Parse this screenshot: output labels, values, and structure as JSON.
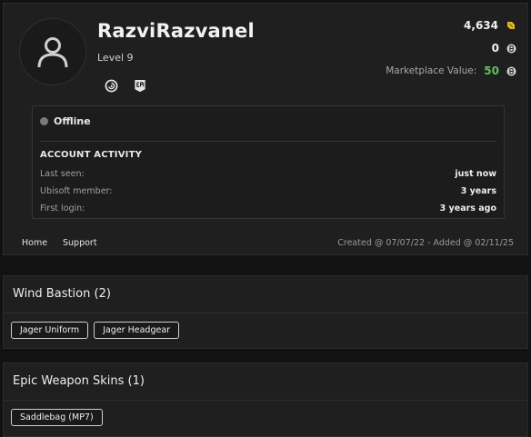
{
  "profile": {
    "username": "RazviRazvanel",
    "level": "Level 9",
    "platforms": [
      "ubisoft-icon",
      "epic-games-icon"
    ],
    "stats": {
      "credits": "4,634",
      "coins": "0",
      "marketplace_label": "Marketplace Value:",
      "marketplace_value": "50"
    },
    "colors": {
      "marketplace_value": "#5fc161",
      "credit_icon": "#e0b62a"
    }
  },
  "activity": {
    "status": "Offline",
    "title": "ACCOUNT ACTIVITY",
    "rows": [
      {
        "label": "Last seen:",
        "value": "just now"
      },
      {
        "label": "Ubisoft member:",
        "value": "3 years"
      },
      {
        "label": "First login:",
        "value": "3 years ago"
      }
    ]
  },
  "footer": {
    "links": [
      "Home",
      "Support"
    ],
    "meta": "Created @ 07/07/22 - Added @ 02/11/25"
  },
  "sections": [
    {
      "title": "Wind Bastion (2)",
      "items": [
        "Jager Uniform",
        "Jager Headgear"
      ]
    },
    {
      "title": "Epic Weapon Skins (1)",
      "items": [
        "Saddlebag (MP7)"
      ]
    }
  ]
}
